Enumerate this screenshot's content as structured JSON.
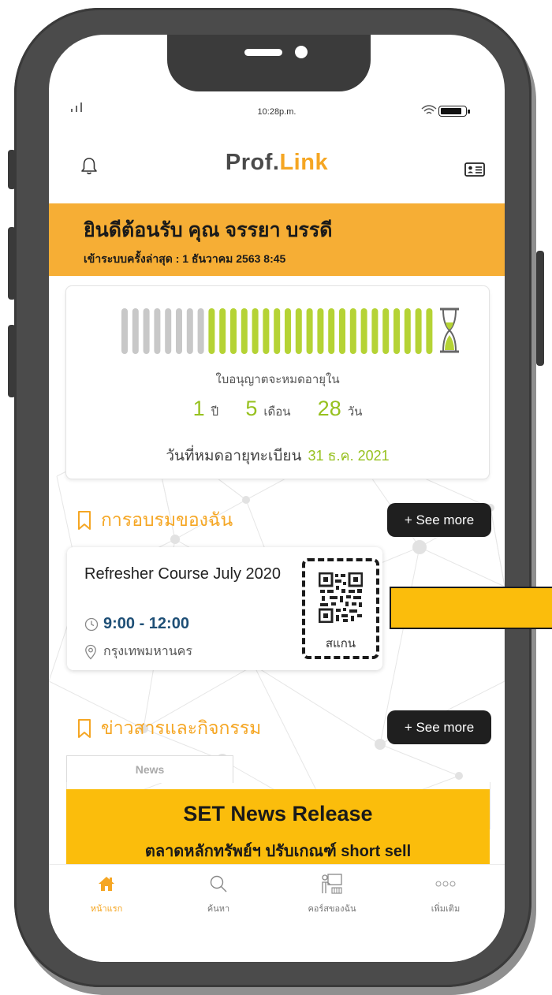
{
  "status_bar": {
    "time": "10:28p.m."
  },
  "header": {
    "brand_part1": "Prof.",
    "brand_part2": "Link"
  },
  "welcome": {
    "title": "ยินดีต้อนรับ คุณ จรรยา บรรดี",
    "last_login": "เข้าระบบครั้งล่าสุด : 1 ธันวาคม 2563 8:45"
  },
  "license": {
    "total_bars": 29,
    "remaining_bars": 21,
    "expire_label": "ใบอนุญาตจะหมดอายุใน",
    "years": "1",
    "years_unit": "ปี",
    "months": "5",
    "months_unit": "เดือน",
    "days": "28",
    "days_unit": "วัน",
    "expire_date_label": "วันที่หมดอายุทะเบียน",
    "expire_date": "31 ธ.ค. 2021"
  },
  "training": {
    "section_title": "การอบรมของฉัน",
    "see_more": "+ See more",
    "course": {
      "title": "Refresher Course July 2020",
      "time": "9:00 - 12:00",
      "location": "กรุงเทพมหานคร",
      "scan_label": "สแกน"
    }
  },
  "news": {
    "section_title": "ข่าวสารและกิจกรรม",
    "see_more": "+ See more",
    "tab_label": "News",
    "banner_title": "SET News Release",
    "banner_subtitle": "ตลาดหลักทรัพย์ฯ ปรับเกณฑ์ short sell"
  },
  "bottom_nav": [
    {
      "label": "หน้าแรก",
      "icon": "home-icon",
      "active": true
    },
    {
      "label": "ค้นหา",
      "icon": "search-icon",
      "active": false
    },
    {
      "label": "คอร์สของฉัน",
      "icon": "course-icon",
      "active": false
    },
    {
      "label": "เพิ่มเติม",
      "icon": "more-icon",
      "active": false
    }
  ],
  "colors": {
    "accent": "#f5a623",
    "banner": "#f6ae35",
    "bar_active": "#b5d335",
    "bar_inactive": "#c8c8c8",
    "highlight": "#97c11f",
    "time_text": "#1e4f76",
    "news_banner": "#fbbd0c"
  }
}
